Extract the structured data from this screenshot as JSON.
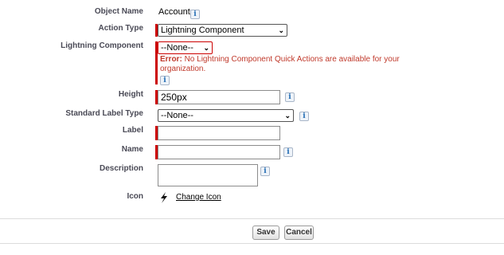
{
  "fields": {
    "object_name": {
      "label": "Object Name",
      "value": "Account"
    },
    "action_type": {
      "label": "Action Type",
      "selected": "Lightning Component"
    },
    "lightning_component": {
      "label": "Lightning Component",
      "selected": "--None--",
      "error_prefix": "Error:",
      "error_line1": " No Lightning Component Quick Actions are available for your",
      "error_line2": "organization."
    },
    "height": {
      "label": "Height",
      "value": "250px"
    },
    "standard_label_type": {
      "label": "Standard Label Type",
      "selected": "--None--"
    },
    "label": {
      "label": "Label",
      "value": ""
    },
    "name": {
      "label": "Name",
      "value": ""
    },
    "description": {
      "label": "Description",
      "value": ""
    },
    "icon": {
      "label": "Icon",
      "link": "Change Icon"
    }
  },
  "info_glyph": "i",
  "buttons": {
    "save": "Save",
    "cancel": "Cancel"
  },
  "colors": {
    "required": "#c00000",
    "error_text": "#c0392b",
    "info_icon": "#1f6ab3"
  }
}
